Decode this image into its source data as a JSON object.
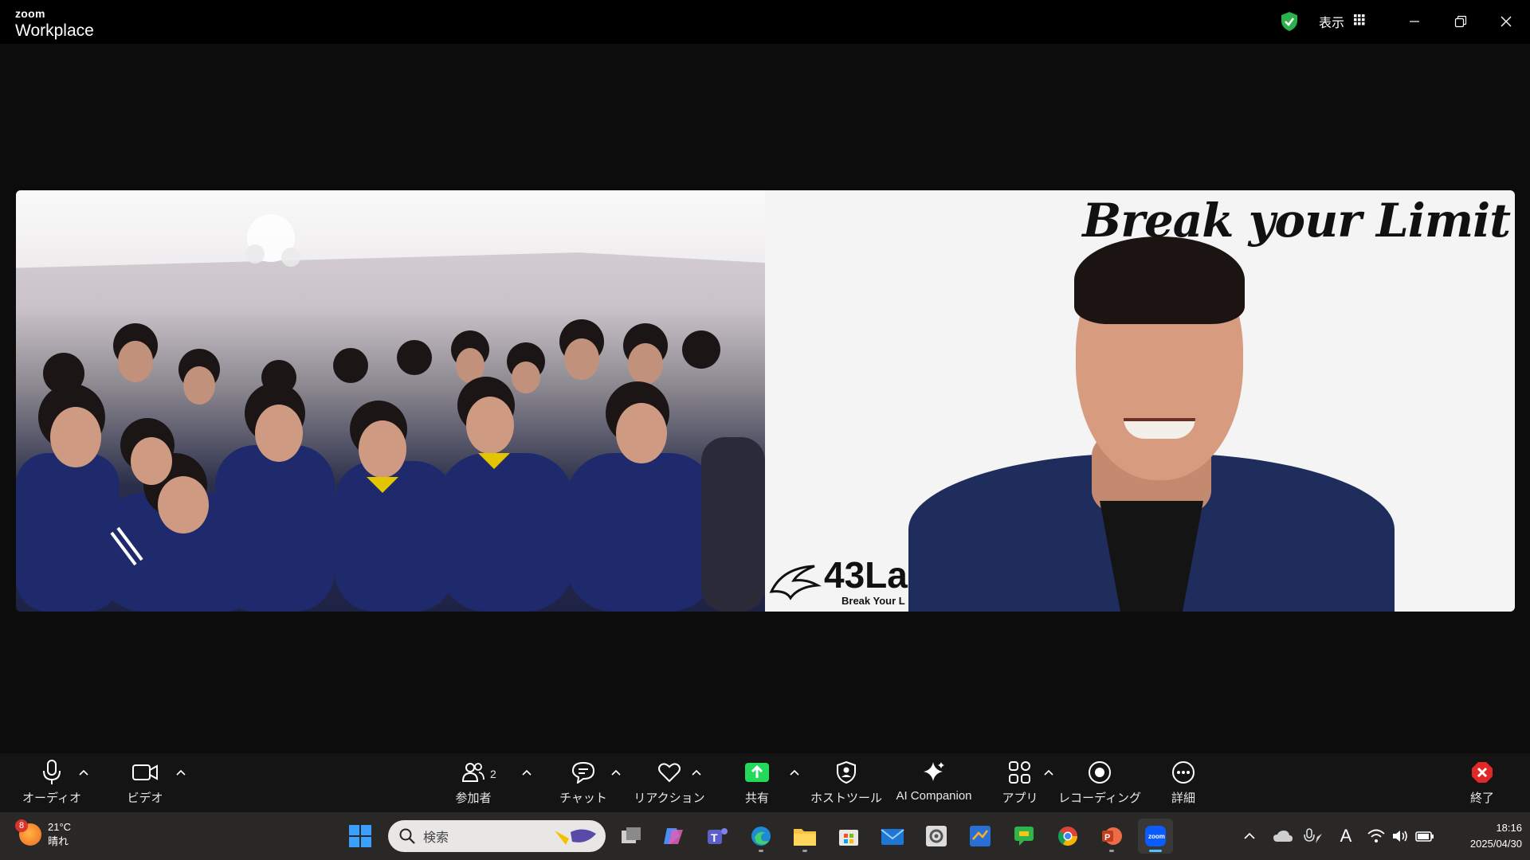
{
  "app": {
    "brand_small": "zoom",
    "brand_large": "Workplace"
  },
  "titlebar": {
    "view_label": "表示"
  },
  "tiles": {
    "right": {
      "slogan": "Break your Limit",
      "logo_text": "43La",
      "logo_sub": "Break Your L"
    }
  },
  "toolbar": {
    "audio": "オーディオ",
    "video": "ビデオ",
    "participants": "参加者",
    "participants_count": "2",
    "chat": "チャット",
    "reactions": "リアクション",
    "share": "共有",
    "host_tools": "ホストツール",
    "ai_companion": "AI Companion",
    "apps": "アプリ",
    "recording": "レコーディング",
    "more": "詳細",
    "end": "終了"
  },
  "taskbar": {
    "weather_temp": "21°C",
    "weather_cond": "晴れ",
    "weather_badge": "8",
    "search_placeholder": "検索",
    "time": "18:16",
    "date": "2025/04/30",
    "ime": "A"
  },
  "colors": {
    "share_green": "#23d959",
    "end_red": "#e02828",
    "shield_green": "#2bb24c",
    "accent": "#4cc2ff"
  }
}
